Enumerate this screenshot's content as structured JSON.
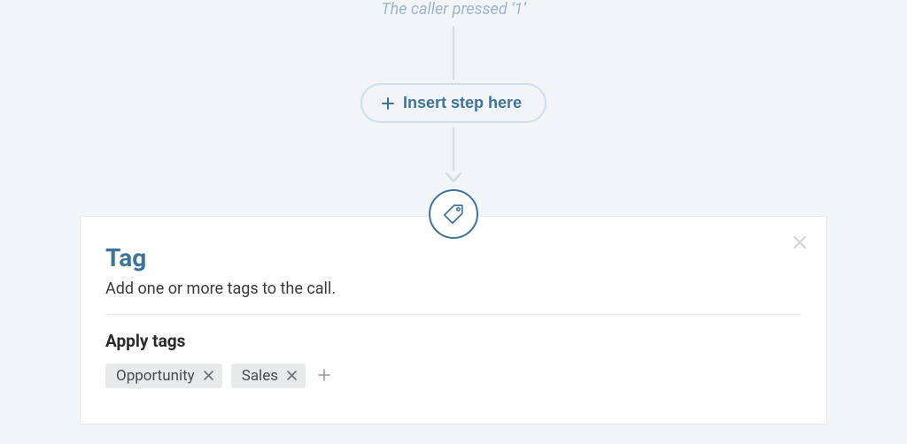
{
  "flow": {
    "caption": "The caller pressed ‘1’",
    "insert_label": "Insert step here"
  },
  "card": {
    "title": "Tag",
    "description": "Add one or more tags to the call.",
    "section_title": "Apply tags",
    "tags": [
      {
        "label": "Opportunity"
      },
      {
        "label": "Sales"
      }
    ]
  },
  "icons": {
    "plus": "plus-icon",
    "tag": "tag-icon",
    "close": "close-icon",
    "x_small": "x-icon"
  }
}
